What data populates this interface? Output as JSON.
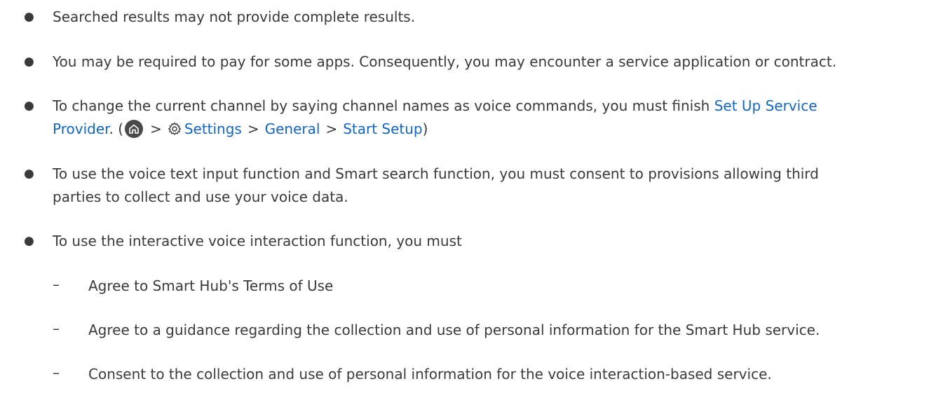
{
  "bullets": [
    {
      "text": "Searched results may not provide complete results."
    },
    {
      "text": "You may be required to pay for some apps. Consequently, you may encounter a service application or contract."
    },
    {
      "prefix": "To change the current channel by saying channel names as voice commands, you must finish ",
      "link1": "Set Up Service",
      "link1b": "Provider",
      "after_link": ". (",
      "settings": "Settings",
      "general": "General",
      "start_setup": "Start Setup",
      "close": ")",
      "chevron": ">"
    },
    {
      "line1": "To use the voice text input function and Smart search function, you must consent to provisions allowing third",
      "line2": "parties to collect and use your voice data."
    },
    {
      "text": "To use the interactive voice interaction function, you must"
    }
  ],
  "sub_items": [
    "Agree to Smart Hub's Terms of Use",
    "Agree to a guidance regarding the collection and use of personal information for the Smart Hub service.",
    "Consent to the collection and use of personal information for the voice interaction-based service."
  ],
  "bullet_char": "●",
  "dash_char": "–",
  "colors": {
    "text": "#3a3a3a",
    "link": "#1466c0"
  },
  "icons": [
    "home-icon",
    "settings-gear-icon"
  ]
}
